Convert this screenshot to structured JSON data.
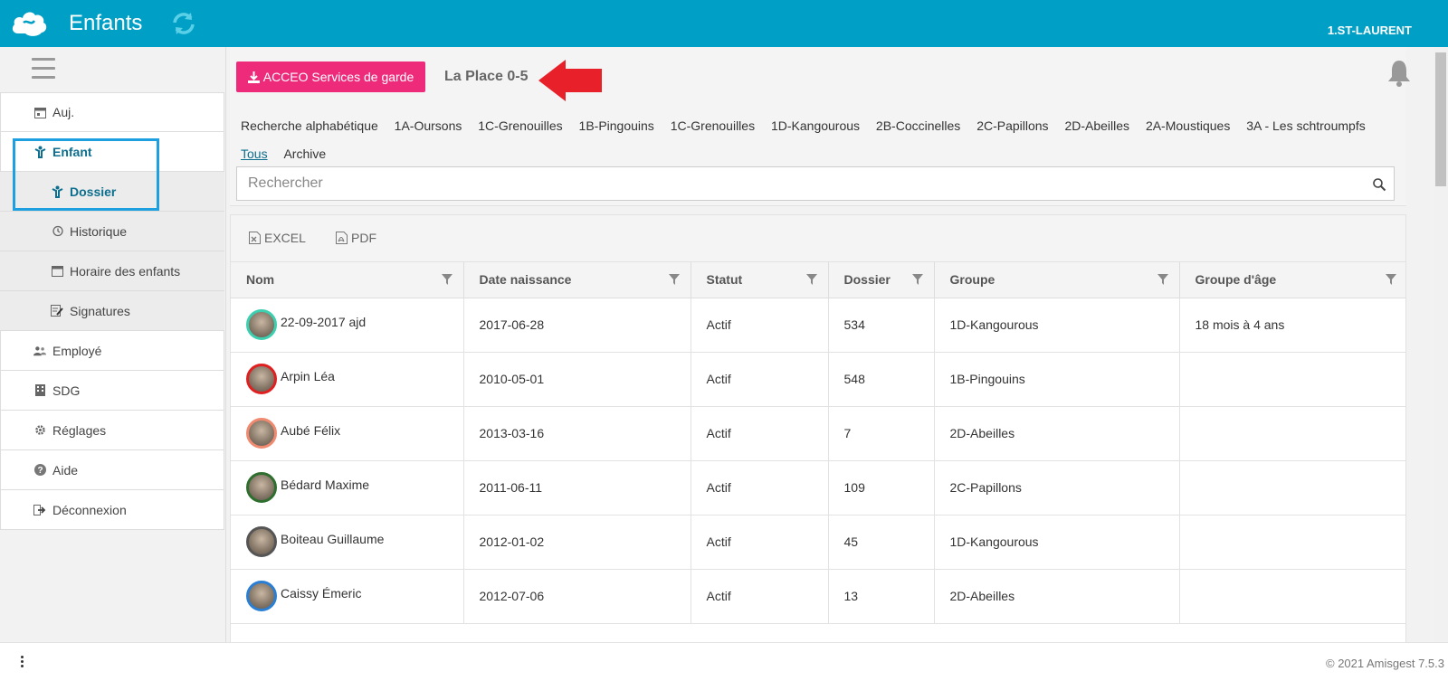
{
  "topbar": {
    "title": "Enfants",
    "user": "1.ST-LAURENT",
    "bg_color": "#00a0c6"
  },
  "sidebar": {
    "items": [
      {
        "label": "Auj.",
        "icon": "calendar-icon"
      },
      {
        "label": "Enfant",
        "icon": "child-icon"
      },
      {
        "label": "Dossier",
        "icon": "child-icon"
      },
      {
        "label": "Historique",
        "icon": "history-icon"
      },
      {
        "label": "Horaire des enfants",
        "icon": "calendar-icon"
      },
      {
        "label": "Signatures",
        "icon": "signature-icon"
      },
      {
        "label": "Employé",
        "icon": "users-icon"
      },
      {
        "label": "SDG",
        "icon": "building-icon"
      },
      {
        "label": "Réglages",
        "icon": "gear-icon"
      },
      {
        "label": "Aide",
        "icon": "help-icon"
      },
      {
        "label": "Déconnexion",
        "icon": "logout-icon"
      }
    ]
  },
  "header": {
    "acceo_button": "ACCEO Services de garde",
    "acceo_color": "#ee2a7b",
    "place": "La Place 0-5"
  },
  "filters": {
    "items": [
      "Recherche alphabétique",
      "1A-Oursons",
      "1C-Grenouilles",
      "1B-Pingouins",
      "1C-Grenouilles",
      "1D-Kangourous",
      "2B-Coccinelles",
      "2C-Papillons",
      "2D-Abeilles",
      "2A-Moustiques",
      "3A - Les schtroumpfs",
      "Tous",
      "Archive"
    ],
    "active": "Tous"
  },
  "search": {
    "placeholder": "Rechercher"
  },
  "export": {
    "excel": "EXCEL",
    "pdf": "PDF"
  },
  "table": {
    "columns": [
      "Nom",
      "Date naissance",
      "Statut",
      "Dossier",
      "Groupe",
      "Groupe d'âge"
    ],
    "rows": [
      {
        "name": "22-09-2017 ajd",
        "birth": "2017-06-28",
        "status": "Actif",
        "file": "534",
        "group": "1D-Kangourous",
        "age_group": "18 mois à 4 ans",
        "avatar_color": "#3ccfb0"
      },
      {
        "name": "Arpin Léa",
        "birth": "2010-05-01",
        "status": "Actif",
        "file": "548",
        "group": "1B-Pingouins",
        "age_group": "",
        "avatar_color": "#e02020"
      },
      {
        "name": "Aubé Félix",
        "birth": "2013-03-16",
        "status": "Actif",
        "file": "7",
        "group": "2D-Abeilles",
        "age_group": "",
        "avatar_color": "#f08a70"
      },
      {
        "name": "Bédard Maxime",
        "birth": "2011-06-11",
        "status": "Actif",
        "file": "109",
        "group": "2C-Papillons",
        "age_group": "",
        "avatar_color": "#2e6e2e"
      },
      {
        "name": "Boiteau Guillaume",
        "birth": "2012-01-02",
        "status": "Actif",
        "file": "45",
        "group": "1D-Kangourous",
        "age_group": "",
        "avatar_color": "#555555"
      },
      {
        "name": "Caissy Émeric",
        "birth": "2012-07-06",
        "status": "Actif",
        "file": "13",
        "group": "2D-Abeilles",
        "age_group": "",
        "avatar_color": "#2a7fd4"
      }
    ]
  },
  "footer": {
    "copyright": "© 2021 Amisgest 7.5.3"
  }
}
